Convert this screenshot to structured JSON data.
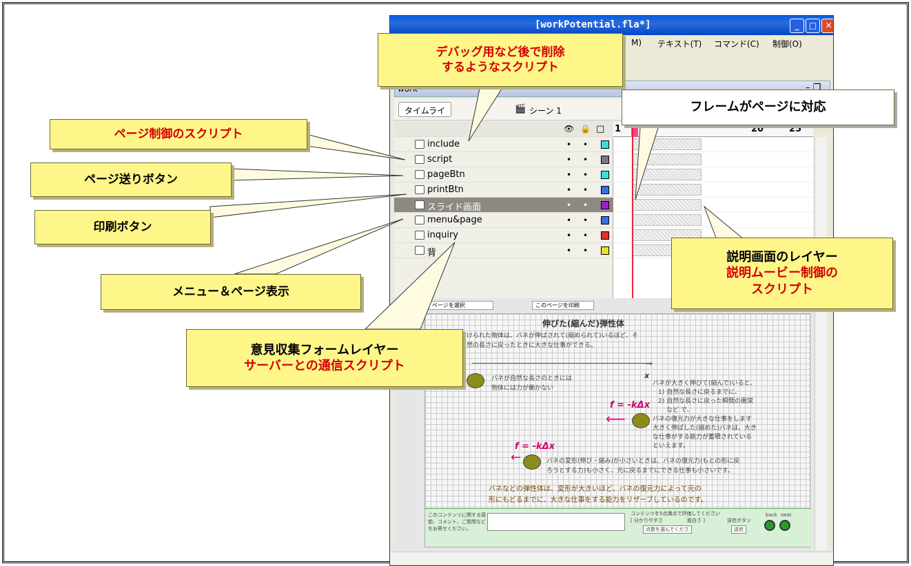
{
  "window": {
    "title": "[workPotential.fla*]",
    "menu": [
      "M)",
      "テキスト(T)",
      "コマンド(C)",
      "制御(O)"
    ],
    "doc_tab": "work",
    "toolbar": {
      "timeline_btn": "タイムライ",
      "scene": "シーン 1"
    }
  },
  "layers": [
    {
      "name": "include",
      "color": "#33e0e0"
    },
    {
      "name": "script",
      "color": "#7a7a7a"
    },
    {
      "name": "pageBtn",
      "color": "#33e0e0"
    },
    {
      "name": "printBtn",
      "color": "#3b6ee0"
    },
    {
      "name": "スライド画面",
      "color": "#9b22c8",
      "selected": true
    },
    {
      "name": "menu&page",
      "color": "#3b6ee0"
    },
    {
      "name": "inquiry",
      "color": "#e03030"
    },
    {
      "name": "背",
      "color": "#f0e020"
    }
  ],
  "ruler": [
    "1",
    "5",
    "20",
    "25"
  ],
  "callouts": {
    "debug": {
      "line1": "デバッグ用など後で削除",
      "line2": "するようなスクリプト"
    },
    "frame": "フレームがページに対応",
    "pagecontrol": "ページ制御のスクリプト",
    "pagebtn": "ページ送りボタン",
    "print": "印刷ボタン",
    "menu": "メニュー＆ページ表示",
    "inquiry": {
      "line1": "意見収集フォームレイヤー",
      "line2": "サーバーとの通信スクリプト"
    },
    "slide": {
      "line1": "説明画面のレイヤー",
      "line2": "説明ムービー制御の",
      "line3": "スクリプト"
    }
  },
  "stage": {
    "heading": "伸びた(縮んだ)弾性体",
    "intro1": "バネに取り付けられた物体は、バネが伸ばされて(縮められて)いるほど、そ",
    "intro2": "の後バネが自然の長さに戻ったときに大きな仕事ができる。",
    "x_label": "x",
    "note_natural1": "バネが自然な長さのときには",
    "note_natural2": "物体には力が働かない",
    "note_big1": "バネが大きく伸びて(縮んで)いると、",
    "note_big2": "1) 自然な長さに戻るまでに、",
    "note_big3": "2) 自然な長さに戻った瞬間の衝突",
    "note_big4": "など で、",
    "note_big5": "バネの復元力が大きな仕事をします",
    "note_red1": "大きく伸ばした(縮めた)バネは、大き",
    "note_red2": "な仕事がする能力が蓄積されている",
    "note_big6": "といえます。",
    "formula": "f = -kΔx",
    "note_small1": "バネの変形(伸び・縮み)が小さいときは、バネの復元力(もとの形に戻",
    "note_small2": "ろうとする力)も小さく、元に戻るまでにできる仕事も小さいです。",
    "summary1": "バネなどの弾性体は、変形が大きいほど、バネの復元力によって元の",
    "summary2": "形にもどるまでに、大きな仕事をする能力をリザーブしているのです。",
    "footer_left": "このコンテンツに関する感想、コメント、ご質問などをお寄せください。",
    "footer_mid": "コンテンツを5点満点で評価してください",
    "footer_scale_l": "[ 分かりやすさ",
    "footer_scale_r": "面白さ ]",
    "footer_select": "点数を選んでくださ",
    "footer_send_label": "送信ボタン",
    "footer_send": "送信",
    "back": "back",
    "next": "next",
    "top_left": "ページを選択",
    "top_mid": "このページを印刷"
  }
}
